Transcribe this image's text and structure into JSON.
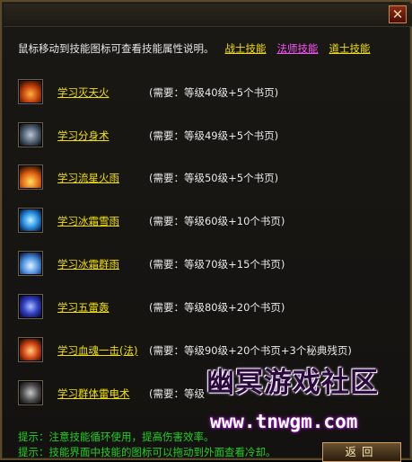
{
  "window": {
    "close_label": "✕"
  },
  "header": {
    "info_text": "鼠标移动到技能图标可查看技能属性说明。",
    "tabs": [
      {
        "label": "战士技能",
        "active": false
      },
      {
        "label": "法师技能",
        "active": true
      },
      {
        "label": "道士技能",
        "active": false
      }
    ]
  },
  "skills": [
    {
      "name": "学习灭天火",
      "requirement": "(需要：等级40级+5个书页)",
      "icon": "fire-skill-icon"
    },
    {
      "name": "学习分身术",
      "requirement": "(需要：等级49级+5个书页)",
      "icon": "clone-skill-icon"
    },
    {
      "name": "学习流星火雨",
      "requirement": "(需要：等级50级+5个书页)",
      "icon": "meteor-skill-icon"
    },
    {
      "name": "学习冰霜雪雨",
      "requirement": "(需要：等级60级+10个书页)",
      "icon": "ice-rain-skill-icon"
    },
    {
      "name": "学习冰霜群雨",
      "requirement": "(需要：等级70级+15个书页)",
      "icon": "frost-group-skill-icon"
    },
    {
      "name": "学习五雷轰",
      "requirement": "(需要：等级80级+20个书页)",
      "icon": "thunder-skill-icon"
    },
    {
      "name": "学习血魂一击(法)",
      "requirement": "(需要：等级90级+20个书页+3个秘典残页)",
      "icon": "blood-soul-skill-icon"
    },
    {
      "name": "学习群体雷电术",
      "requirement": "(需要：等级",
      "icon": "group-lightning-skill-icon"
    }
  ],
  "tips": [
    "提示：注意技能循环使用，提高伤害效率。",
    "提示：技能界面中技能的图标可以拖动到外面查看冷却。"
  ],
  "footer": {
    "return_label": "返回"
  },
  "watermark": {
    "title": "幽冥游戏社区",
    "url": "www.tnwgm.com"
  }
}
